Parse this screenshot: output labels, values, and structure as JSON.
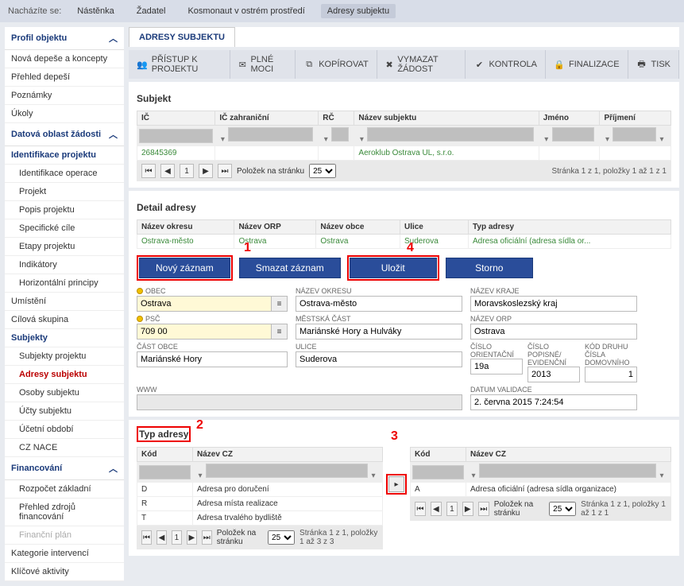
{
  "breadcrumb": {
    "label": "Nacházíte se:",
    "items": [
      "Nástěnka",
      "Žadatel",
      "Kosmonaut v ostrém prostředí",
      "Adresy subjektu"
    ]
  },
  "sidebar": {
    "s1": {
      "title": "Profil objektu",
      "items": [
        "Nová depeše a koncepty",
        "Přehled depeší",
        "Poznámky",
        "Úkoly"
      ]
    },
    "s2": {
      "title": "Datová oblast žádosti"
    },
    "identifikace": "Identifikace projektu",
    "idOperace": "Identifikace operace",
    "projekt": "Projekt",
    "popis": "Popis projektu",
    "spec": "Specifické cíle",
    "etapy": "Etapy projektu",
    "indik": "Indikátory",
    "horiz": "Horizontální principy",
    "umisteni": "Umístění",
    "cilova": "Cílová skupina",
    "subjekty": "Subjekty",
    "subjektyP": "Subjekty projektu",
    "adresySub": "Adresy subjektu",
    "osoby": "Osoby subjektu",
    "ucty": "Účty subjektu",
    "ucetni": "Účetní období",
    "cznace": "CZ NACE",
    "financ": "Financování",
    "rozpocet": "Rozpočet základní",
    "prehled": "Přehled zdrojů financování",
    "finplan": "Finanční plán",
    "kateg": "Kategorie intervencí",
    "klicove": "Klíčové aktivity"
  },
  "tab": {
    "title": "ADRESY SUBJEKTU"
  },
  "toolbar": {
    "pristup": "PŘÍSTUP K PROJEKTU",
    "plne": "PLNÉ MOCI",
    "kopirovat": "KOPÍROVAT",
    "vymazat": "VYMAZAT ŽÁDOST",
    "kontrola": "KONTROLA",
    "finalizace": "FINALIZACE",
    "tisk": "TISK"
  },
  "subjekt": {
    "title": "Subjekt",
    "cols": {
      "ic": "IČ",
      "icz": "IČ zahraniční",
      "rc": "RČ",
      "nazev": "Název subjektu",
      "jmeno": "Jméno",
      "prijmeni": "Příjmení"
    },
    "row": {
      "ic": "26845369",
      "nazev": "Aeroklub Ostrava UL, s.r.o."
    },
    "polozek": "Položek na stránku",
    "info": "Stránka 1 z 1, položky 1 až 1 z 1"
  },
  "detail": {
    "title": "Detail adresy",
    "cols": {
      "okres": "Název okresu",
      "orp": "Název ORP",
      "obce": "Název obce",
      "ulice": "Ulice",
      "typ": "Typ adresy"
    },
    "row": {
      "okres": "Ostrava-město",
      "orp": "Ostrava",
      "obce": "Ostrava",
      "ulice": "Suderova",
      "typ": "Adresa oficiální (adresa sídla or..."
    }
  },
  "buttons": {
    "novy": "Nový záznam",
    "smazat": "Smazat záznam",
    "ulozit": "Uložit",
    "storno": "Storno"
  },
  "form": {
    "obec": {
      "label": "OBEC",
      "value": "Ostrava"
    },
    "okres": {
      "label": "NÁZEV OKRESU",
      "value": "Ostrava-město"
    },
    "kraj": {
      "label": "NÁZEV KRAJE",
      "value": "Moravskoslezský kraj"
    },
    "psc": {
      "label": "PSČ",
      "value": "709 00"
    },
    "mcast": {
      "label": "MĚSTSKÁ ČÁST",
      "value": "Mariánské Hory a Hulváky"
    },
    "orp": {
      "label": "NÁZEV ORP",
      "value": "Ostrava"
    },
    "castobce": {
      "label": "ČÁST OBCE",
      "value": "Mariánské Hory"
    },
    "ulice": {
      "label": "ULICE",
      "value": "Suderova"
    },
    "cislo_or": {
      "label": "ČÍSLO ORIENTAČNÍ",
      "value": "19a"
    },
    "cislo_pop": {
      "label": "ČÍSLO POPISNÉ/ EVIDENČNÍ",
      "value": "2013"
    },
    "kod_druhu": {
      "label": "KÓD DRUHU ČÍSLA DOMOVNÍHO",
      "value": "1"
    },
    "www": {
      "label": "WWW",
      "value": ""
    },
    "datum": {
      "label": "DATUM VALIDACE",
      "value": "2. června 2015 7:24:54"
    }
  },
  "typ": {
    "title": "Typ adresy",
    "cols": {
      "kod": "Kód",
      "nazev": "Název CZ"
    },
    "left": [
      {
        "kod": "D",
        "nazev": "Adresa pro doručení"
      },
      {
        "kod": "R",
        "nazev": "Adresa místa realizace"
      },
      {
        "kod": "T",
        "nazev": "Adresa trvalého bydliště"
      }
    ],
    "right": [
      {
        "kod": "A",
        "nazev": "Adresa oficiální (adresa sídla organizace)"
      }
    ],
    "polozek": "Položek na stránku",
    "infoL": "Stránka 1 z 1, položky 1 až 3 z 3",
    "infoR": "Stránka 1 z 1, položky 1 až 1 z 1"
  },
  "markers": {
    "n1": "1",
    "n2": "2",
    "n3": "3",
    "n4": "4"
  },
  "pgsize": "25"
}
